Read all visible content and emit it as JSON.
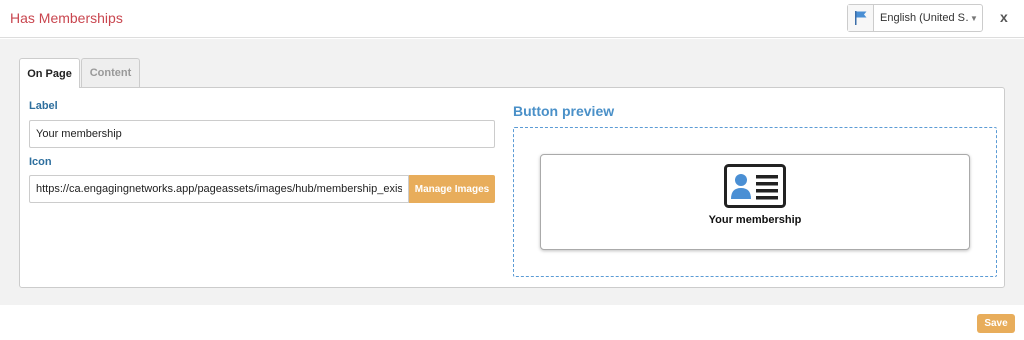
{
  "header": {
    "title": "Has Memberships",
    "language": "English (United S…",
    "close_label": "x"
  },
  "tabs": [
    {
      "label": "On Page",
      "active": true
    },
    {
      "label": "Content",
      "active": false
    }
  ],
  "form": {
    "label_heading": "Label",
    "label_value": "Your membership",
    "icon_heading": "Icon",
    "icon_value": "https://ca.engagingnetworks.app/pageassets/images/hub/membership_exists.p",
    "manage_images_label": "Manage Images"
  },
  "preview": {
    "heading": "Button preview",
    "button_label": "Your membership",
    "icon": "membership-card-icon"
  },
  "footer": {
    "save_label": "Save"
  },
  "colors": {
    "title": "#c9464f",
    "accent_orange": "#e8ad5b",
    "label_blue": "#2e6f9e",
    "preview_blue": "#4a90c8"
  }
}
